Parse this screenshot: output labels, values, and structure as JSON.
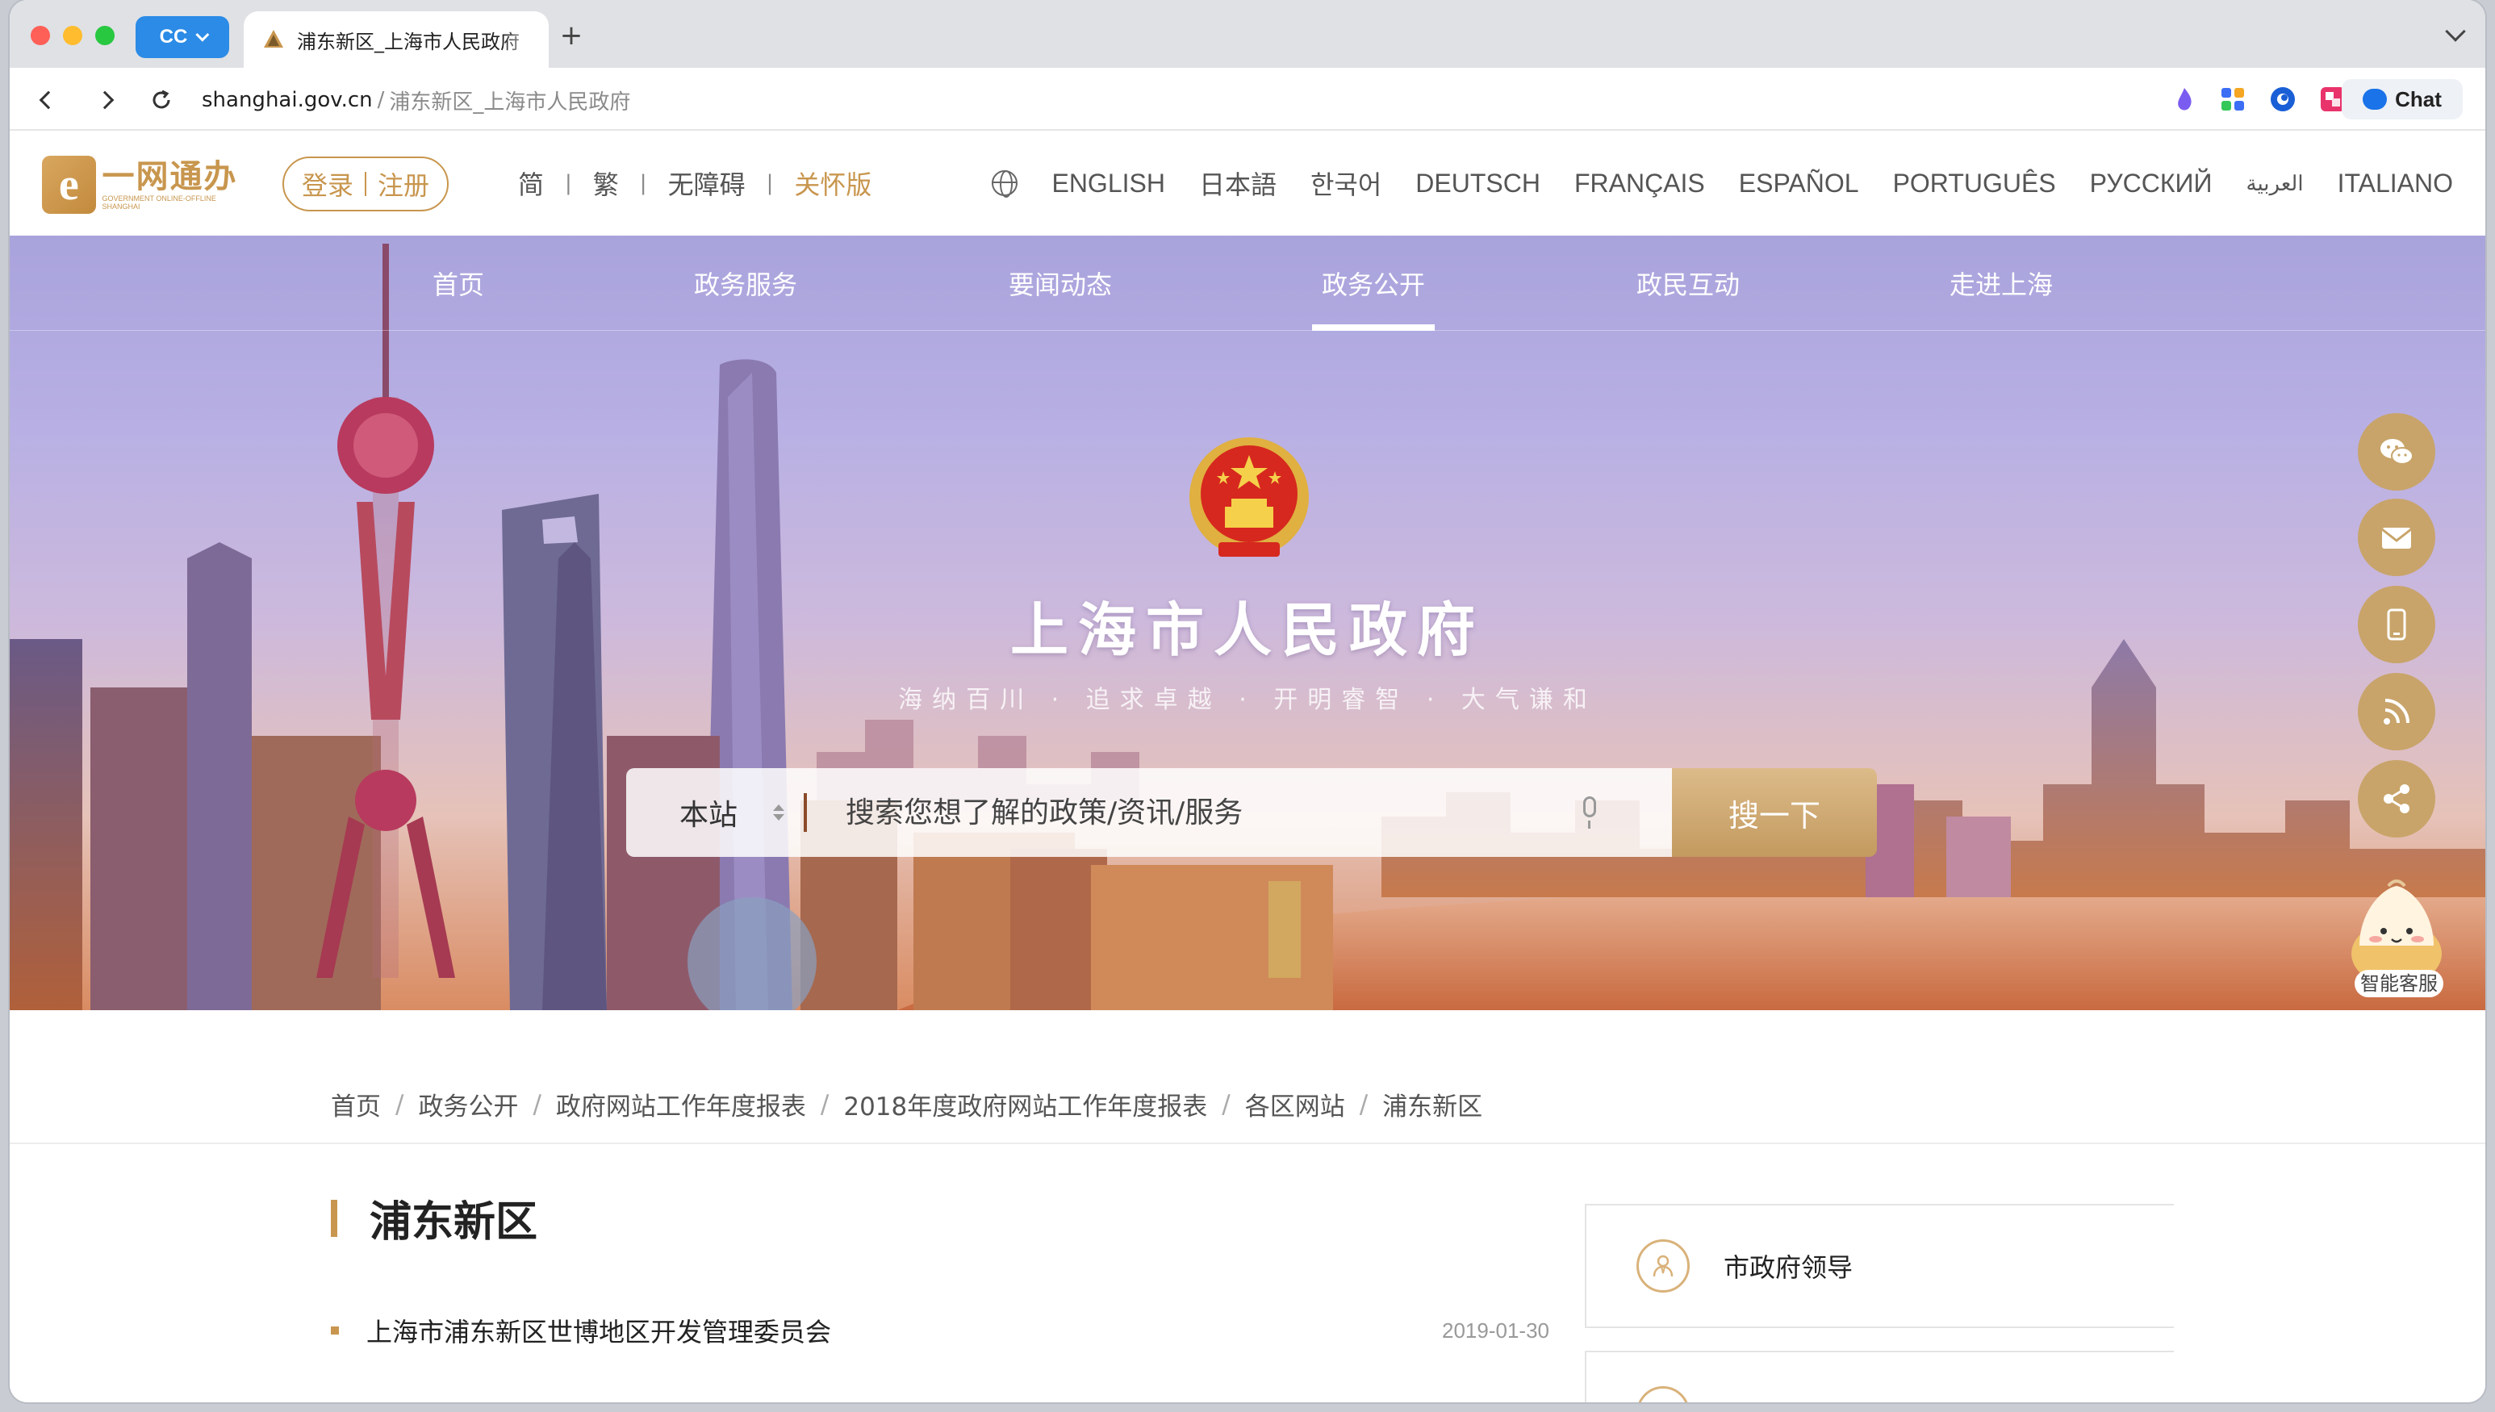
{
  "browser": {
    "profile_label": "CC",
    "tab_title": "浦东新区_上海市人民政府",
    "new_tab_symbol": "+",
    "url_host": "shanghai.gov.cn",
    "url_separator": "/",
    "url_path": "浦东新区_上海市人民政府",
    "chat_label": "Chat",
    "accent": "#2b8be6"
  },
  "header": {
    "logo_mark": "e",
    "logo_text": "一网通办",
    "logo_subtext": "GOVERNMENT ONLINE-OFFLINE SHANGHAI",
    "login_label": "登录",
    "register_label": "注册",
    "script_options": [
      "简",
      "繁",
      "无障碍",
      "关怀版"
    ],
    "script_separator": "|",
    "languages": [
      "ENGLISH",
      "日本語",
      "한국어",
      "DEUTSCH",
      "FRANÇAIS",
      "ESPAÑOL",
      "PORTUGUÊS",
      "РУССКИЙ",
      "العربية",
      "ITALIANO"
    ],
    "accent": "#c8964e"
  },
  "main_nav": {
    "items": [
      "首页",
      "政务服务",
      "要闻动态",
      "政务公开",
      "政民互动",
      "走进上海"
    ],
    "active_item": "政务公开"
  },
  "hero": {
    "title": "上海市人民政府",
    "subtitle": "海纳百川 · 追求卓越 · 开明睿智 · 大气谦和",
    "search_scope": "本站",
    "search_placeholder": "搜索您想了解的政策/资讯/服务",
    "search_button": "搜一下"
  },
  "float_bar": {
    "buttons": [
      "wechat-icon",
      "mail-icon",
      "mobile-icon",
      "rss-icon",
      "share-icon"
    ],
    "assistant_label": "智能客服"
  },
  "breadcrumb": {
    "items": [
      "首页",
      "政务公开",
      "政府网站工作年度报表",
      "2018年度政府网站工作年度报表",
      "各区网站",
      "浦东新区"
    ],
    "separator": "/"
  },
  "content": {
    "section_title": "浦东新区",
    "items": [
      {
        "title": "上海市浦东新区世博地区开发管理委员会",
        "date": "2019-01-30"
      }
    ]
  },
  "sidebar": {
    "cards": [
      {
        "label": "市政府领导",
        "icon": "leader-icon"
      },
      {
        "label": "",
        "icon": "card-icon"
      }
    ]
  }
}
